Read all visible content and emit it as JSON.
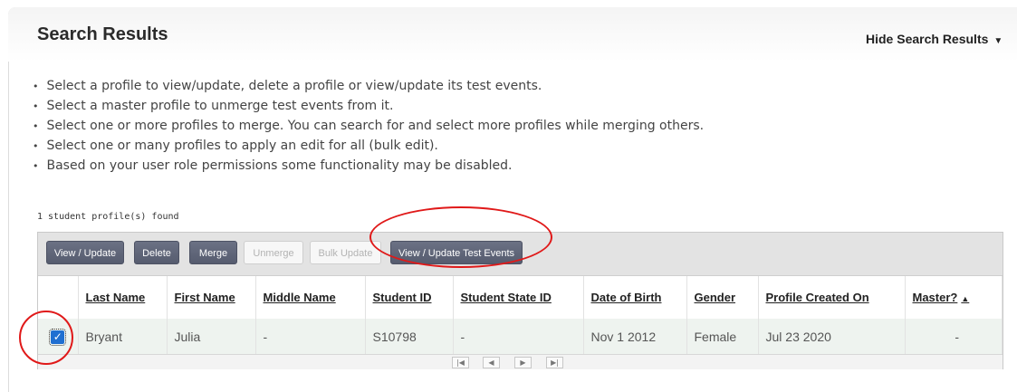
{
  "header": {
    "title": "Search Results",
    "hide_link": "Hide Search Results",
    "caret_icon": "caret-down-icon"
  },
  "instructions": [
    "Select a profile to view/update, delete a profile or view/update its test events.",
    "Select a master profile to unmerge test events from it.",
    "Select one or more profiles to merge. You can search for and select more profiles while merging others.",
    "Select one or many profiles to apply an edit for all (bulk edit).",
    "Based on your user role permissions some functionality may be disabled."
  ],
  "results_count": "1 student profile(s) found",
  "toolbar": {
    "view_update": "View / Update",
    "delete": "Delete",
    "merge": "Merge",
    "unmerge": "Unmerge",
    "bulk_update": "Bulk Update",
    "view_update_test_events": "View / Update Test Events"
  },
  "table": {
    "columns": [
      "Last Name",
      "First Name",
      "Middle Name",
      "Student ID",
      "Student State ID",
      "Date of Birth",
      "Gender",
      "Profile Created On",
      "Master?"
    ],
    "sort_indicator": "▲",
    "rows": [
      {
        "selected": true,
        "last_name": "Bryant",
        "first_name": "Julia",
        "middle_name": "-",
        "student_id": "S10798",
        "student_state_id": "-",
        "date_of_birth": "Nov 1 2012",
        "gender": "Female",
        "profile_created_on": "Jul 23 2020",
        "master": "-"
      }
    ]
  },
  "pager": {
    "first_icon": "first-page-icon",
    "prev_icon": "prev-page-icon",
    "next_icon": "next-page-icon",
    "last_icon": "last-page-icon"
  },
  "colors": {
    "button": "#5f6578",
    "selected_row": "#eef3ef",
    "annotation": "#e01919",
    "checkbox": "#1f6fd1"
  }
}
